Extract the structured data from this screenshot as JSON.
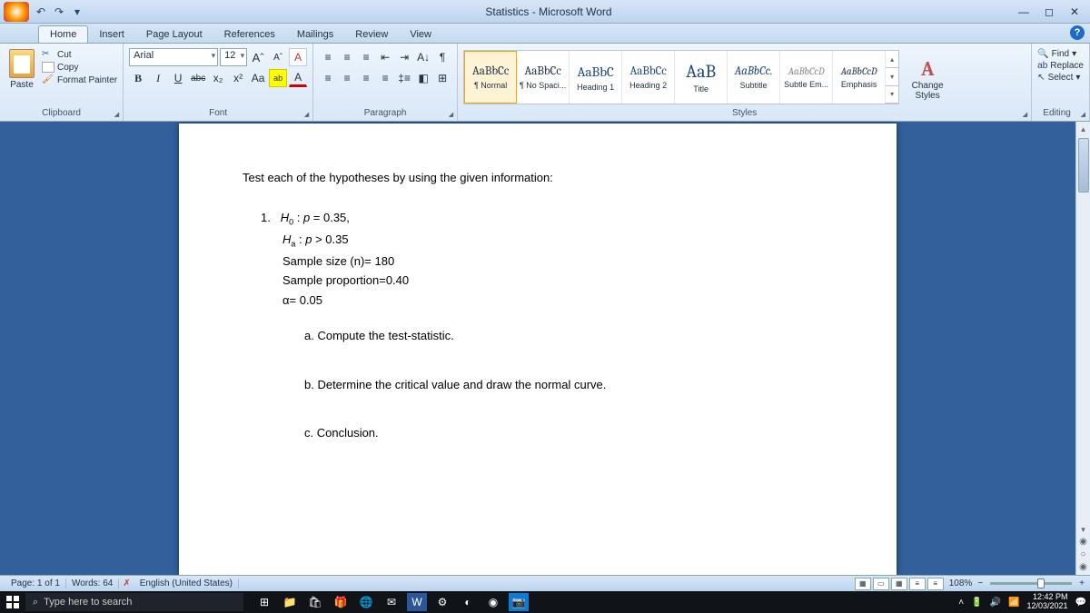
{
  "title": "Statistics - Microsoft Word",
  "qat": {
    "undo": "↶",
    "redo": "↷",
    "more": "▾"
  },
  "tabs": [
    "Home",
    "Insert",
    "Page Layout",
    "References",
    "Mailings",
    "Review",
    "View"
  ],
  "clipboard": {
    "label": "Clipboard",
    "paste": "Paste",
    "cut": "Cut",
    "copy": "Copy",
    "format_painter": "Format Painter"
  },
  "font": {
    "label": "Font",
    "name": "Arial",
    "size": "12",
    "grow": "Â",
    "shrink": "Â",
    "clear": "A⃠",
    "bold": "B",
    "italic": "I",
    "underline": "U",
    "strike": "abc",
    "sub": "x₂",
    "sup": "x²",
    "case": "Aa",
    "highlight": "ab",
    "color": "A"
  },
  "paragraph": {
    "label": "Paragraph"
  },
  "styles": {
    "label": "Styles",
    "items": [
      {
        "preview": "AaBbCc",
        "name": "¶ Normal"
      },
      {
        "preview": "AaBbCc",
        "name": "¶ No Spaci..."
      },
      {
        "preview": "AaBbC",
        "name": "Heading 1"
      },
      {
        "preview": "AaBbCc",
        "name": "Heading 2"
      },
      {
        "preview": "AaB",
        "name": "Title"
      },
      {
        "preview": "AaBbCc.",
        "name": "Subtitle"
      },
      {
        "preview": "AaBbCcD",
        "name": "Subtle Em..."
      },
      {
        "preview": "AaBbCcD",
        "name": "Emphasis"
      }
    ],
    "change": "Change Styles"
  },
  "editing": {
    "label": "Editing",
    "find": "Find",
    "replace": "Replace",
    "select": "Select"
  },
  "document": {
    "instruction": "Test each of the hypotheses by using the given information:",
    "lines": [
      "1.   H₀ : p = 0.35,",
      "Hₐ : p > 0.35",
      "Sample size (n)= 180",
      "Sample proportion=0.40",
      "α= 0.05"
    ],
    "subs": [
      "a.  Compute the test-statistic.",
      "b.  Determine the critical value and draw the normal curve.",
      "c.  Conclusion."
    ]
  },
  "status": {
    "page": "Page: 1 of 1",
    "words": "Words: 64",
    "lang": "English (United States)",
    "zoom": "108%"
  },
  "taskbar": {
    "search_placeholder": "Type here to search",
    "time": "12:42 PM",
    "date": "12/03/2021"
  }
}
